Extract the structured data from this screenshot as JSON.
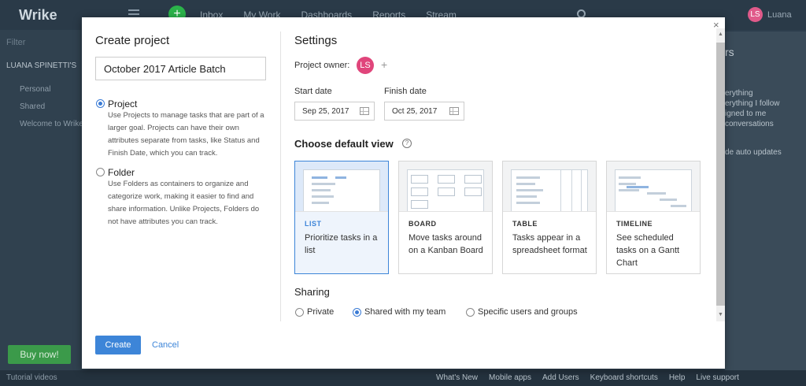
{
  "background": {
    "logo": "Wrike",
    "nav": [
      "Inbox",
      "My Work",
      "Dashboards",
      "Reports",
      "Stream"
    ],
    "user_initials": "LS",
    "user_name": "Luana",
    "filter_label": "Filter",
    "sidebar_user": "LUANA SPINETTI'S",
    "sidebar_items": [
      "Personal",
      "Shared",
      "Welcome to Wrike"
    ],
    "buy_now": "Buy now!",
    "right_panel_title": "rs",
    "right_panel_lines": [
      "erything",
      "erything I follow",
      "igned to me",
      "conversations",
      "de auto updates"
    ],
    "tutorial": "Tutorial videos",
    "bottom_links": [
      "What's New",
      "Mobile apps",
      "Add Users",
      "Keyboard shortcuts",
      "Help",
      "Live support"
    ]
  },
  "modal": {
    "close": "×",
    "title": "Create project",
    "project_name": "October 2017 Article Batch",
    "options": [
      {
        "label": "Project",
        "selected": true,
        "description": "Use Projects to manage tasks that are part of a larger goal. Projects can have their own attributes separate from tasks, like Status and Finish Date, which you can track."
      },
      {
        "label": "Folder",
        "selected": false,
        "description": "Use Folders as containers to organize and categorize work, making it easier to find and share information. Unlike Projects, Folders do not have attributes you can track."
      }
    ],
    "create_label": "Create",
    "cancel_label": "Cancel",
    "settings": {
      "title": "Settings",
      "owner_label": "Project owner:",
      "owner_initials": "LS",
      "owner_add": "+",
      "start_label": "Start date",
      "start_value": "Sep 25, 2017",
      "finish_label": "Finish date",
      "finish_value": "Oct 25, 2017",
      "view_title": "Choose default view",
      "help": "?",
      "views": [
        {
          "name": "LIST",
          "desc": "Prioritize tasks in a list",
          "selected": true
        },
        {
          "name": "BOARD",
          "desc": "Move tasks around on a Kanban Board",
          "selected": false
        },
        {
          "name": "TABLE",
          "desc": "Tasks appear in a spreadsheet format",
          "selected": false
        },
        {
          "name": "TIMELINE",
          "desc": "See scheduled tasks on a Gantt Chart",
          "selected": false
        }
      ],
      "sharing_title": "Sharing",
      "sharing_options": [
        {
          "label": "Private",
          "selected": false
        },
        {
          "label": "Shared with my team",
          "selected": true
        },
        {
          "label": "Specific users and groups",
          "selected": false
        }
      ]
    }
  },
  "colors": {
    "accent": "#3d85d8",
    "avatar": "#e0457b",
    "plus": "#2bb34a"
  }
}
